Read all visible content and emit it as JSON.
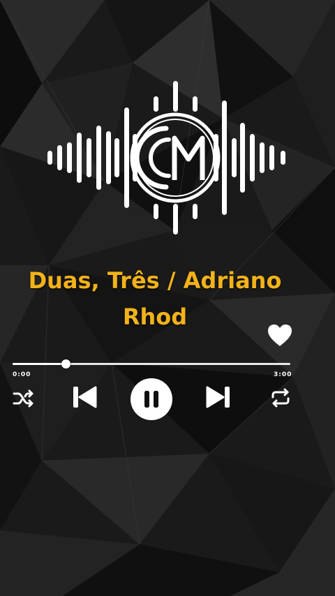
{
  "now_playing": {
    "title_line1": "Duas,  Três /  Adriano",
    "title_line2": "Rhod",
    "progress_fraction": 0.19,
    "elapsed_time": "0:00",
    "total_time": "3:00"
  },
  "colors": {
    "title": "#f2b21a",
    "background": "#111111",
    "icons": "#ffffff"
  },
  "icons": {
    "logo": "cm-waveform-logo-icon",
    "favorite": "heart-icon",
    "shuffle": "shuffle-icon",
    "previous": "skip-previous-icon",
    "play_pause": "pause-icon",
    "next": "skip-next-icon",
    "repeat": "repeat-icon"
  }
}
